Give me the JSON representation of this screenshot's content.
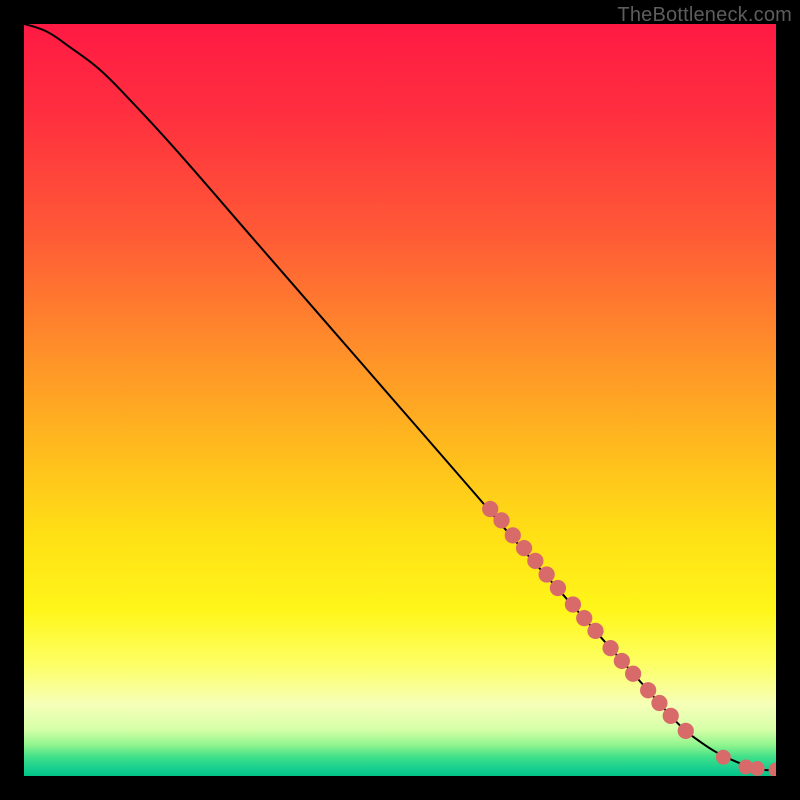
{
  "attribution": "TheBottleneck.com",
  "colors": {
    "frame": "#000000",
    "curve": "#000000",
    "marker_fill": "#d96a6a",
    "marker_stroke": "#cf5a5a",
    "gradient_stops": [
      {
        "offset": 0.0,
        "color": "#ff1a44"
      },
      {
        "offset": 0.12,
        "color": "#ff2f3f"
      },
      {
        "offset": 0.28,
        "color": "#ff5a36"
      },
      {
        "offset": 0.42,
        "color": "#ff8a2b"
      },
      {
        "offset": 0.55,
        "color": "#ffb61f"
      },
      {
        "offset": 0.68,
        "color": "#ffe015"
      },
      {
        "offset": 0.78,
        "color": "#fff61a"
      },
      {
        "offset": 0.85,
        "color": "#fdff63"
      },
      {
        "offset": 0.905,
        "color": "#f6ffb8"
      },
      {
        "offset": 0.938,
        "color": "#d6ffa8"
      },
      {
        "offset": 0.958,
        "color": "#93f58e"
      },
      {
        "offset": 0.975,
        "color": "#3fe08a"
      },
      {
        "offset": 0.99,
        "color": "#17cf8f"
      },
      {
        "offset": 1.0,
        "color": "#00c486"
      }
    ]
  },
  "chart_data": {
    "type": "line",
    "title": "",
    "xlabel": "",
    "ylabel": "",
    "xlim": [
      0,
      100
    ],
    "ylim": [
      0,
      100
    ],
    "grid": false,
    "legend": false,
    "series": [
      {
        "name": "curve",
        "x": [
          0,
          3,
          6,
          10,
          14,
          20,
          30,
          40,
          50,
          60,
          66,
          70,
          74,
          78,
          82,
          86,
          88,
          90,
          92,
          94,
          96,
          97.5,
          98.5,
          100
        ],
        "y": [
          100,
          99,
          97,
          94,
          90,
          83.5,
          72,
          60.5,
          49,
          37.5,
          30.5,
          26,
          21.5,
          17,
          12.5,
          8,
          6,
          4.5,
          3.2,
          2.2,
          1.4,
          1.0,
          0.8,
          0.8
        ]
      }
    ],
    "markers": [
      {
        "x": 62,
        "y": 35.5,
        "r": 1.2
      },
      {
        "x": 63.5,
        "y": 34,
        "r": 1.2
      },
      {
        "x": 65,
        "y": 32,
        "r": 1.2
      },
      {
        "x": 66.5,
        "y": 30.3,
        "r": 1.2
      },
      {
        "x": 68,
        "y": 28.6,
        "r": 1.2
      },
      {
        "x": 69.5,
        "y": 26.8,
        "r": 1.2
      },
      {
        "x": 71,
        "y": 25,
        "r": 1.2
      },
      {
        "x": 73,
        "y": 22.8,
        "r": 1.2
      },
      {
        "x": 74.5,
        "y": 21,
        "r": 1.2
      },
      {
        "x": 76,
        "y": 19.3,
        "r": 1.2
      },
      {
        "x": 78,
        "y": 17,
        "r": 1.2
      },
      {
        "x": 79.5,
        "y": 15.3,
        "r": 1.2
      },
      {
        "x": 81,
        "y": 13.6,
        "r": 1.2
      },
      {
        "x": 83,
        "y": 11.4,
        "r": 1.2
      },
      {
        "x": 84.5,
        "y": 9.7,
        "r": 1.2
      },
      {
        "x": 86,
        "y": 8,
        "r": 1.2
      },
      {
        "x": 88,
        "y": 6,
        "r": 1.2
      },
      {
        "x": 93,
        "y": 2.5,
        "r": 1.1
      },
      {
        "x": 96,
        "y": 1.2,
        "r": 1.1
      },
      {
        "x": 97.5,
        "y": 1.0,
        "r": 1.1
      },
      {
        "x": 100,
        "y": 0.8,
        "r": 1.1
      }
    ]
  }
}
